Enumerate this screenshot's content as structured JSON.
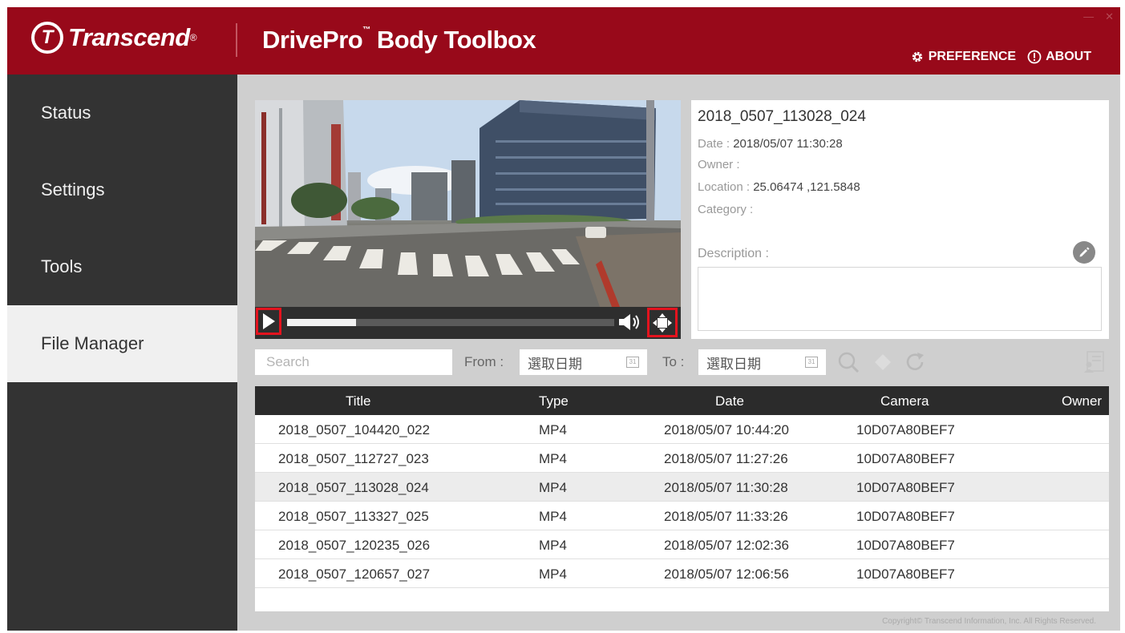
{
  "header": {
    "brand": "Transcend",
    "app_title": "DrivePro",
    "app_title_tm": "™",
    "app_title_rest": " Body Toolbox",
    "preference_label": "PREFERENCE",
    "about_label": "ABOUT",
    "bg_color": "#98091a"
  },
  "sidebar": {
    "items": [
      {
        "label": "Status"
      },
      {
        "label": "Settings"
      },
      {
        "label": "Tools"
      },
      {
        "label": "File Manager"
      }
    ],
    "active": "File Manager"
  },
  "player": {
    "progress": 0.21,
    "highlight_color": "#e4131e"
  },
  "details": {
    "title": "2018_0507_113028_024",
    "date_label": "Date :",
    "date_value": "2018/05/07 11:30:28",
    "owner_label": "Owner :",
    "owner_value": "",
    "location_label": "Location :",
    "location_value": "25.06474 ,121.5848",
    "category_label": "Category :",
    "category_value": "",
    "description_label": "Description :",
    "description_value": ""
  },
  "filters": {
    "search_placeholder": "Search",
    "from_label": "From :",
    "from_value": "選取日期",
    "to_label": "To :",
    "to_value": "選取日期"
  },
  "table": {
    "columns": [
      "Title",
      "Type",
      "Date",
      "Camera",
      "Owner"
    ],
    "rows": [
      {
        "title": "2018_0507_104420_022",
        "type": "MP4",
        "date": "2018/05/07 10:44:20",
        "camera": "10D07A80BEF7",
        "owner": ""
      },
      {
        "title": "2018_0507_112727_023",
        "type": "MP4",
        "date": "2018/05/07 11:27:26",
        "camera": "10D07A80BEF7",
        "owner": ""
      },
      {
        "title": "2018_0507_113028_024",
        "type": "MP4",
        "date": "2018/05/07 11:30:28",
        "camera": "10D07A80BEF7",
        "owner": ""
      },
      {
        "title": "2018_0507_113327_025",
        "type": "MP4",
        "date": "2018/05/07 11:33:26",
        "camera": "10D07A80BEF7",
        "owner": ""
      },
      {
        "title": "2018_0507_120235_026",
        "type": "MP4",
        "date": "2018/05/07 12:02:36",
        "camera": "10D07A80BEF7",
        "owner": ""
      },
      {
        "title": "2018_0507_120657_027",
        "type": "MP4",
        "date": "2018/05/07 12:06:56",
        "camera": "10D07A80BEF7",
        "owner": ""
      }
    ],
    "selected_index": 2
  },
  "footer": {
    "copyright": "Copyright© Transcend Information, Inc. All Rights Reserved."
  }
}
